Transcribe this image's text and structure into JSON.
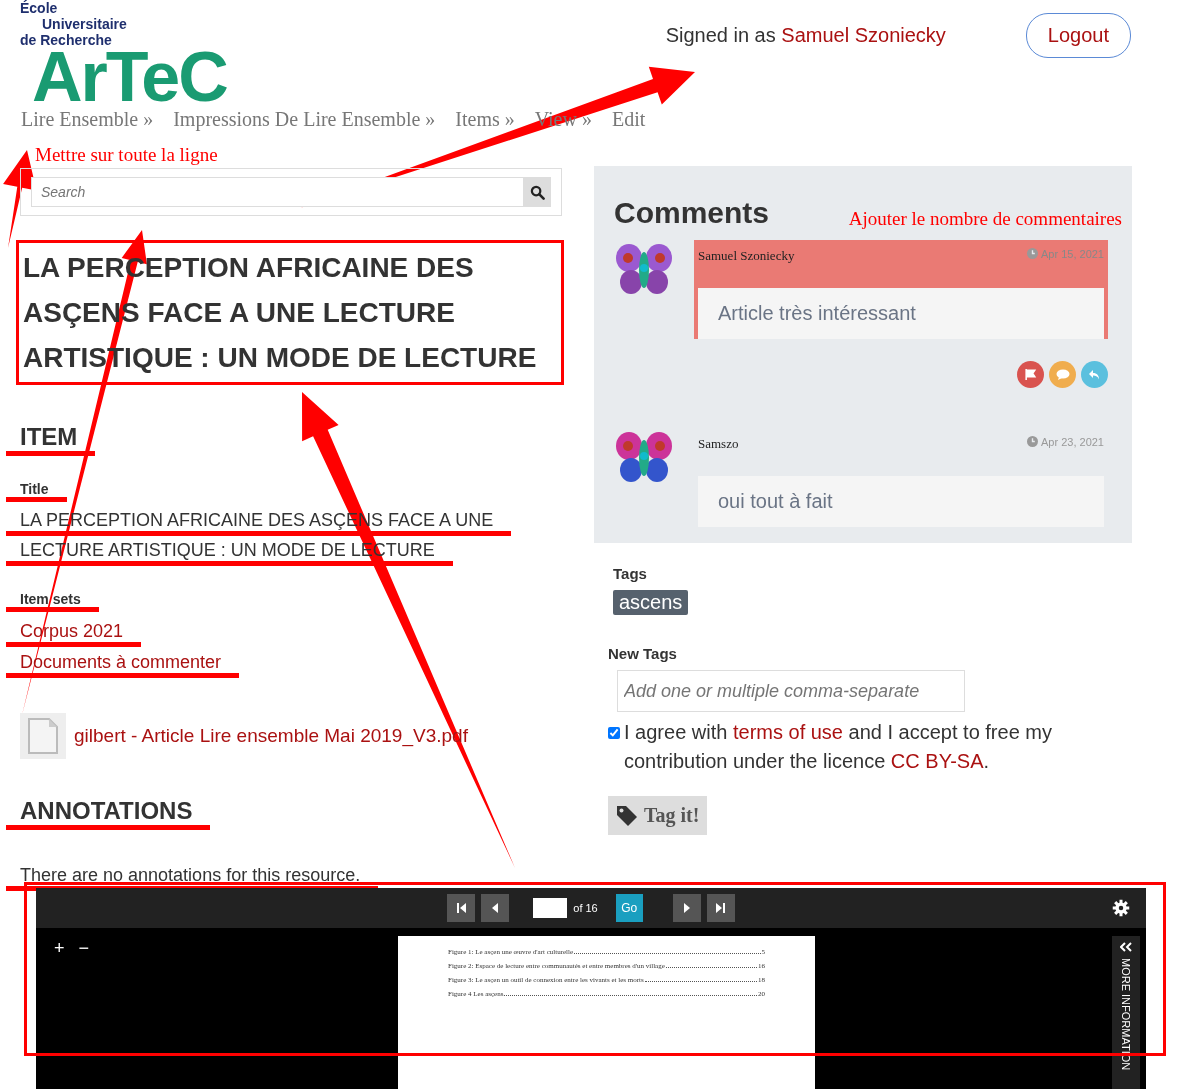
{
  "header": {
    "logo": {
      "line_1": "École",
      "line_2": "Universitaire",
      "line_3": "de Recherche",
      "wordmark": "ArTeC"
    },
    "signed_in_label": "Signed in as",
    "user_name": "Samuel Szoniecky",
    "logout": "Logout"
  },
  "breadcrumb": [
    {
      "label": "Lire Ensemble »"
    },
    {
      "label": "Impressions De Lire Ensemble »"
    },
    {
      "label": "Items »"
    },
    {
      "label": "View »"
    },
    {
      "label": "Edit"
    }
  ],
  "search": {
    "note": "Mettre sur toute la ligne",
    "placeholder": "Search"
  },
  "title": {
    "text": "LA PERCEPTION AFRICAINE DES ASÇENS FACE A UNE LECTURE ARTISTIQUE : UN MODE DE LECTURE",
    "boxed": true
  },
  "item_section": [
    {
      "kind": "heading",
      "text": "ITEM",
      "struck": true
    },
    {
      "kind": "label",
      "text": "Title",
      "struck": true
    },
    {
      "kind": "value",
      "text": "LA PERCEPTION AFRICAINE DES ASÇENS FACE A UNE",
      "struck": true
    },
    {
      "kind": "value",
      "text": "LECTURE ARTISTIQUE : UN MODE DE LECTURE",
      "struck": true
    },
    {
      "kind": "label",
      "text": "Item sets",
      "struck": true
    },
    {
      "kind": "link",
      "text": "Corpus 2021",
      "struck": true
    },
    {
      "kind": "link",
      "text": "Documents à commenter",
      "struck": true
    }
  ],
  "media": {
    "file_name": "gilbert - Article Lire ensemble Mai 2019_V3.pdf"
  },
  "annotations_section": [
    {
      "kind": "heading",
      "text": "ANNOTATIONS",
      "struck": true
    },
    {
      "kind": "text",
      "text": "There are no annotations for this resource.",
      "struck": true
    }
  ],
  "comments": {
    "title": "Comments",
    "note": "Ajouter le nombre de commentaires",
    "items": [
      {
        "author": "Samuel Szoniecky",
        "date": "Apr 15, 2021",
        "body": "Article très intéressant",
        "highlighted": true,
        "actions": true
      },
      {
        "author": "Samszo",
        "date": "Apr 23, 2021",
        "body": "oui tout à fait",
        "highlighted": false,
        "actions": false
      }
    ]
  },
  "tags": {
    "label": "Tags",
    "items": [
      {
        "label": "ascens"
      }
    ],
    "new_label": "New Tags",
    "placeholder": "Add one or multiple comma-separate",
    "agree": {
      "checked": true,
      "text_1": "I agree with ",
      "terms_link": "terms of use",
      "text_2": " and I accept to free my contribution under the licence ",
      "licence_link": "CC BY-SA",
      "text_3": "."
    },
    "button": "Tag it!"
  },
  "viewer": {
    "page_count": "of 16",
    "go": "Go",
    "zoom_in": "+",
    "zoom_out": "−",
    "side_tab": "MORE INFORMATION",
    "boxed": true,
    "page_lines": [
      {
        "caption": "Figure 1: Le asçen une œuvre d'art culturelle",
        "page": "5"
      },
      {
        "caption": "Figure 2: Espace de lecture entre communautés et entre membres d'un village",
        "page": "16"
      },
      {
        "caption": "Figure 3: Le asçen un outil de connexion entre les vivants et les morts",
        "page": "18"
      },
      {
        "caption": "Figure 4 Les asçens",
        "page": "20"
      }
    ]
  }
}
